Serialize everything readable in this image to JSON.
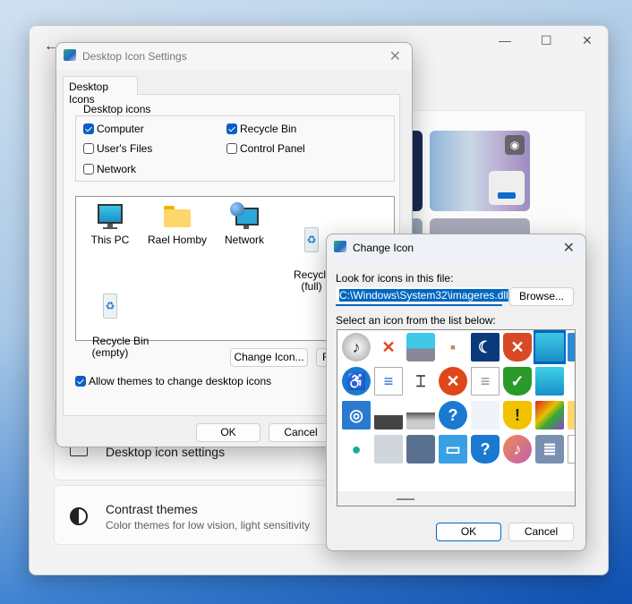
{
  "settings_window": {
    "caption": {
      "minimize": "—",
      "maximize": "☐",
      "close": "✕"
    },
    "back_icon": "←",
    "cards": [
      {
        "title": "Desktop icon settings",
        "icon": "desktop-icon"
      },
      {
        "title": "Contrast themes",
        "subtitle": "Color themes for low vision, light sensitivity",
        "icon": "contrast-icon"
      }
    ]
  },
  "desktop_icon_settings": {
    "title": "Desktop Icon Settings",
    "tab": "Desktop Icons",
    "group_label": "Desktop icons",
    "checkboxes": [
      {
        "label": "Computer",
        "checked": true
      },
      {
        "label": "Recycle Bin",
        "checked": true
      },
      {
        "label": "User's Files",
        "checked": false
      },
      {
        "label": "Control Panel",
        "checked": false
      },
      {
        "label": "Network",
        "checked": false
      }
    ],
    "icons": [
      {
        "label": "This PC",
        "icon": "monitor-icon"
      },
      {
        "label": "Rael Homby",
        "icon": "folder-icon"
      },
      {
        "label": "Network",
        "icon": "network-icon"
      },
      {
        "label": "Recycle Bin\n(full)",
        "icon": "recycle-bin-full-icon"
      },
      {
        "label": "Recycle Bin\n(empty)",
        "icon": "recycle-bin-empty-icon"
      }
    ],
    "change_icon_label": "Change Icon...",
    "restore_default_label": "R",
    "allow_themes": {
      "label": "Allow themes to change desktop icons",
      "checked": true
    },
    "ok_label": "OK",
    "cancel_label": "Cancel"
  },
  "change_icon": {
    "title": "Change Icon",
    "file_label": "Look for icons in this file:",
    "file_value": "C:\\Windows\\System32\\imageres.dll",
    "browse_label": "Browse...",
    "list_label": "Select an icon from the list below:",
    "selected_index": 6,
    "icons": [
      "cd-music-icon",
      "red-x-icon",
      "phone-icon",
      "box-icon",
      "monitor-night-icon",
      "shield-x-icon",
      "monitor-icon",
      "partial-icon",
      "accessibility-icon",
      "document-text-icon",
      "text-cursor-icon",
      "error-icon",
      "document-icon",
      "shield-check-icon",
      "display-icon",
      "gear-partial-icon",
      "media-cd-icon",
      "drive-icon",
      "scanner-icon",
      "help-icon",
      "projector-screen-icon",
      "shield-warning-icon",
      "programs-icon",
      "folder-partial-icon",
      "user-icon",
      "panel-icon",
      "tablet-icon",
      "screen-fast-icon",
      "shield-help-icon",
      "music-icon",
      "news-icon",
      "partial-icon-2"
    ],
    "ok_label": "OK",
    "cancel_label": "Cancel",
    "accent": "#0067c0"
  }
}
